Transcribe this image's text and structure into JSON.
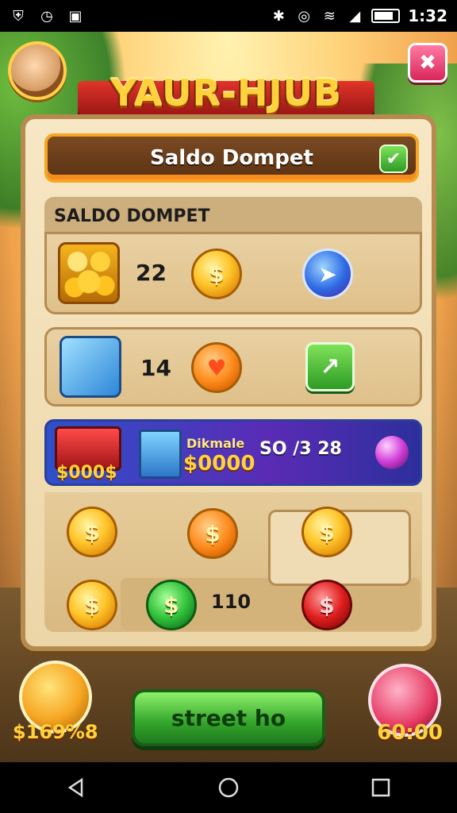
{
  "statusbar": {
    "time": "1:32",
    "icons": [
      "shield-icon",
      "alarm-icon",
      "photo-icon",
      "bluetooth-icon",
      "vibrate-icon",
      "wifi-icon",
      "signal-icon",
      "battery-icon"
    ]
  },
  "header": {
    "logo_text": "YAUR-HJUB",
    "panel_title": "Saldo Dompet"
  },
  "section": {
    "label": "SALDO DOMPET"
  },
  "rows": [
    {
      "value": "22",
      "coin_symbol": "$"
    },
    {
      "value": "14",
      "coin_symbol": "♥"
    }
  ],
  "promo": {
    "price_left": "$000$",
    "title": "Dikmale",
    "price_main": "$0000",
    "stat": "SO /3 28"
  },
  "grid": {
    "coins": [
      "$",
      "$",
      "$",
      "$",
      "$",
      "$"
    ],
    "value": "110"
  },
  "bottom": {
    "left_label": "$169%8",
    "main_button": "street ho",
    "right_label": "60:00"
  },
  "colors": {
    "primary_green": "#33a52b",
    "gold": "#ffd23c",
    "panel": "#f7e7c4"
  }
}
